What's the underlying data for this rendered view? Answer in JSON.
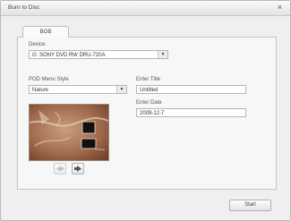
{
  "window": {
    "title": "Burn to Disc"
  },
  "tabs": [
    {
      "label": "BOB"
    }
  ],
  "device": {
    "label": "Device:",
    "value": "G: SONY DVD RW DRU-720A"
  },
  "menu_style": {
    "label": "POD Menu Style",
    "value": "Nature"
  },
  "title_field": {
    "label": "Enter Title",
    "value": "Untitled"
  },
  "date_field": {
    "label": "Enter Date",
    "value": "2009-12-7"
  },
  "preview": {
    "nav_prev_icon": "arrow-left-icon",
    "nav_next_icon": "arrow-right-icon"
  },
  "footer": {
    "start_label": "Start"
  },
  "colors": {
    "dialog_bg": "#efefef",
    "panel_bg": "#f7f7f7",
    "border": "#b9b9b9"
  }
}
